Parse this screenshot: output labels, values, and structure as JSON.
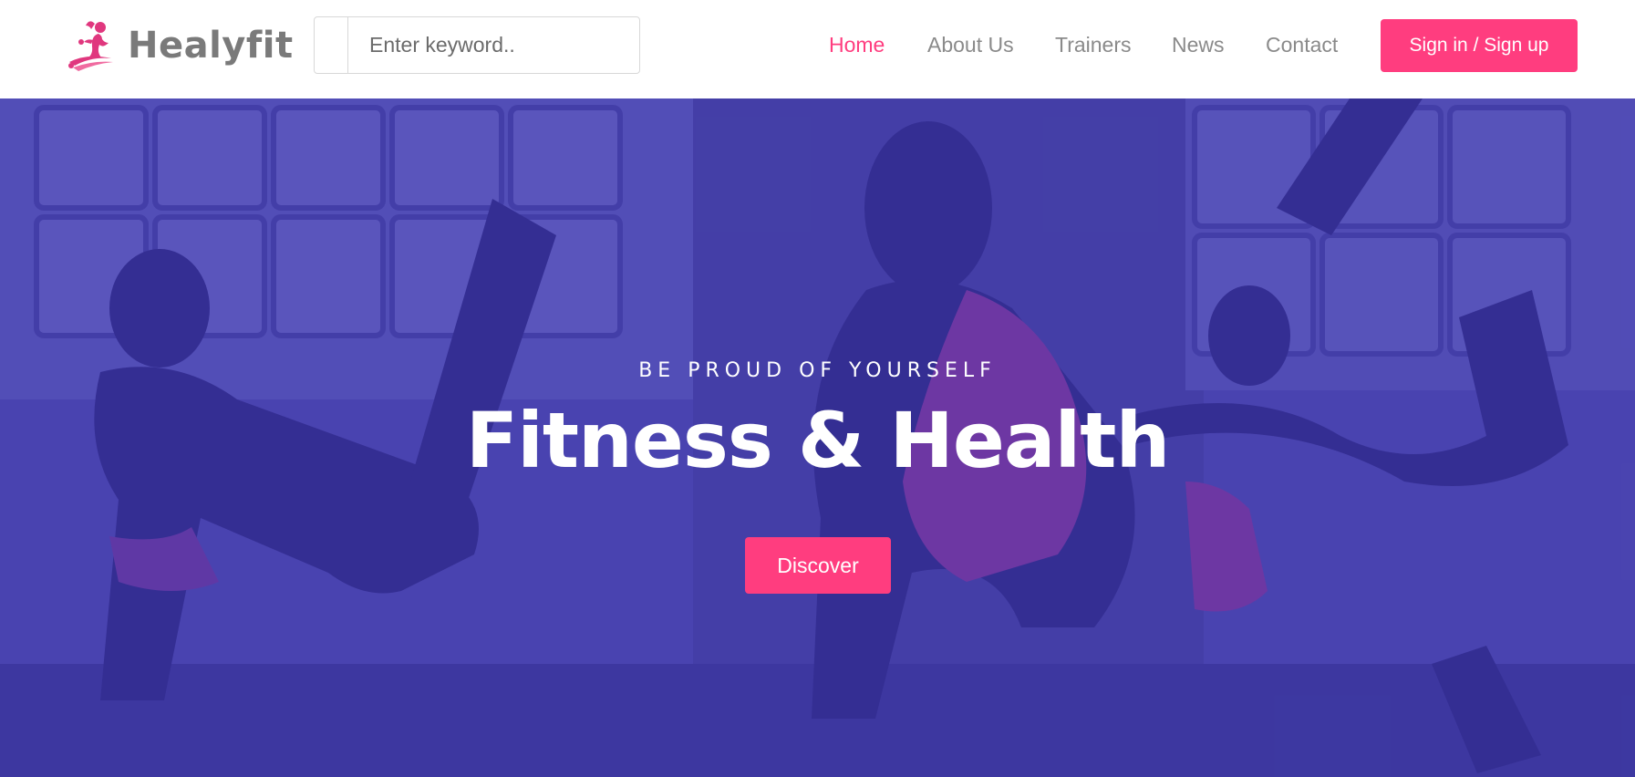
{
  "header": {
    "logo": {
      "text": "Healyfit",
      "icon": "fitness-woman-icon"
    },
    "search": {
      "placeholder": "Enter keyword..",
      "value": "",
      "icon": "search-icon"
    },
    "nav": [
      {
        "label": "Home",
        "active": true
      },
      {
        "label": "About Us",
        "active": false
      },
      {
        "label": "Trainers",
        "active": false
      },
      {
        "label": "News",
        "active": false
      },
      {
        "label": "Contact",
        "active": false
      }
    ],
    "signin_label": "Sign in / Sign up"
  },
  "hero": {
    "tagline": "BE PROUD OF YOURSELF",
    "title": "Fitness & Health",
    "cta_label": "Discover"
  },
  "colors": {
    "accent": "#ff3d7f",
    "logo_text": "#7a7a7a",
    "nav_text": "#8a8a8a",
    "hero_overlay": "#3c37aa"
  }
}
